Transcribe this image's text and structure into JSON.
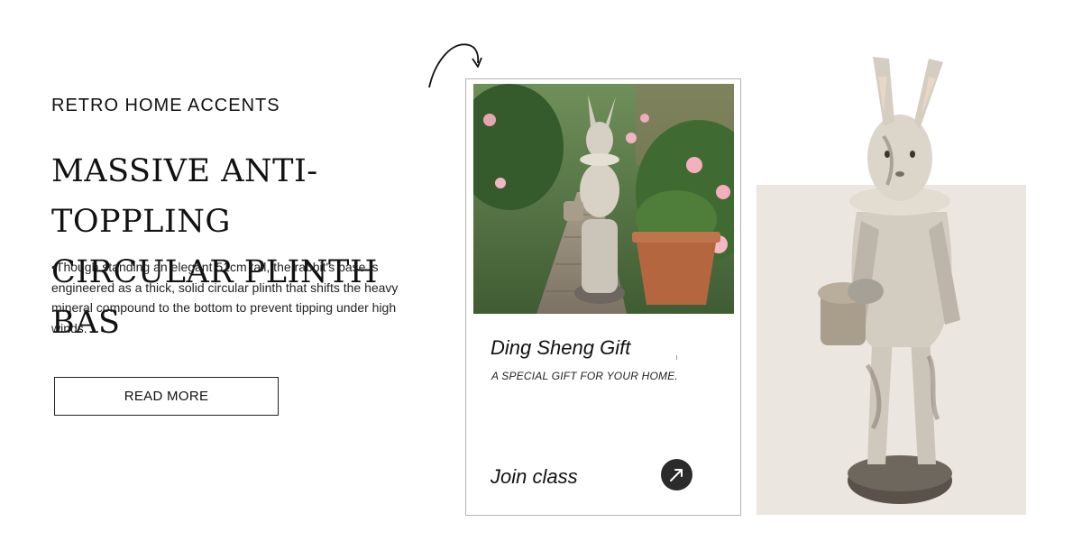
{
  "hero": {
    "eyebrow": "RETRO HOME ACCENTS",
    "headline_line1": "MASSIVE ANTI-TOPPLING",
    "headline_line2": "CIRCULAR PLINTH BAS",
    "body": "•Though standing an elegant 51cm tall, the rabbit's base is engineered as a thick, solid circular plinth that shifts the heavy mineral compound to the bottom to prevent tipping under high winds.",
    "button_label": "READ MORE"
  },
  "card": {
    "title": "Ding Sheng Gift",
    "subtitle": "A SPECIAL GIFT FOR YOUR HOME.",
    "cta_label": "Join class"
  },
  "colors": {
    "background": "#ffffff",
    "text": "#111111",
    "beige_panel": "#ebe6df",
    "round_button": "#2b2b2b",
    "card_border": "#b5b5b5"
  },
  "icons": {
    "decorative_arrow": "curved-arrow-icon",
    "cta_arrow": "arrow-up-right-icon"
  }
}
